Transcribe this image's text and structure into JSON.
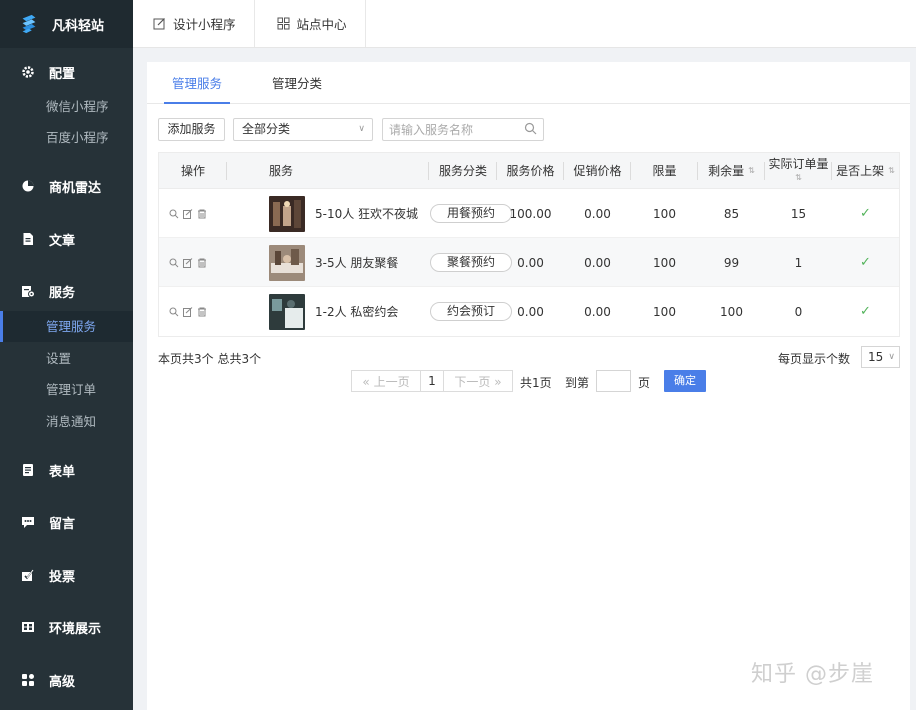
{
  "brand": {
    "name": "凡科轻站"
  },
  "topbar": {
    "tabs": [
      {
        "label": "设计小程序",
        "icon": "edit-icon"
      },
      {
        "label": "站点中心",
        "icon": "grid-icon"
      }
    ]
  },
  "sidebar": {
    "groups": [
      {
        "label": "配置",
        "icon": "gear-icon",
        "items": [
          "微信小程序",
          "百度小程序"
        ]
      },
      {
        "label": "商机雷达",
        "icon": "radar-icon",
        "items": []
      },
      {
        "label": "文章",
        "icon": "document-icon",
        "items": []
      },
      {
        "label": "服务",
        "icon": "service-icon",
        "items": [
          "管理服务",
          "设置",
          "管理订单",
          "消息通知"
        ],
        "active_item": "管理服务"
      },
      {
        "label": "表单",
        "icon": "form-icon",
        "items": []
      },
      {
        "label": "留言",
        "icon": "message-icon",
        "items": []
      },
      {
        "label": "投票",
        "icon": "vote-icon",
        "items": []
      },
      {
        "label": "环境展示",
        "icon": "gallery-icon",
        "items": []
      },
      {
        "label": "高级",
        "icon": "apps-icon",
        "items": []
      }
    ]
  },
  "main": {
    "tabs": [
      "管理服务",
      "管理分类"
    ],
    "active_tab": "管理服务",
    "toolbar": {
      "add_label": "添加服务",
      "category_select": "全部分类",
      "search_placeholder": "请输入服务名称"
    },
    "table": {
      "columns": [
        "操作",
        "服务",
        "服务分类",
        "服务价格",
        "促销价格",
        "限量",
        "剩余量",
        "实际订单量",
        "是否上架"
      ],
      "rows": [
        {
          "name": "5-10人 狂欢不夜城",
          "category": "用餐预约",
          "price": "100.00",
          "promo": "0.00",
          "limit": "100",
          "remaining": "85",
          "orders": "15",
          "listed": "✓"
        },
        {
          "name": "3-5人 朋友聚餐",
          "category": "聚餐预约",
          "price": "0.00",
          "promo": "0.00",
          "limit": "100",
          "remaining": "99",
          "orders": "1",
          "listed": "✓"
        },
        {
          "name": "1-2人 私密约会",
          "category": "约会预订",
          "price": "0.00",
          "promo": "0.00",
          "limit": "100",
          "remaining": "100",
          "orders": "0",
          "listed": "✓"
        }
      ]
    },
    "footer": {
      "summary": "本页共3个  总共3个",
      "per_page_label": "每页显示个数",
      "per_page_value": "15",
      "prev": "« 上一页",
      "page": "1",
      "next": "下一页 »",
      "total_pages": "共1页",
      "goto_label": "到第",
      "page_unit": "页",
      "confirm": "确定"
    }
  },
  "watermark": "知乎 @步崖",
  "colors": {
    "sidebar": "#263238",
    "accent": "#4a7ee8",
    "check": "#52b35a"
  }
}
